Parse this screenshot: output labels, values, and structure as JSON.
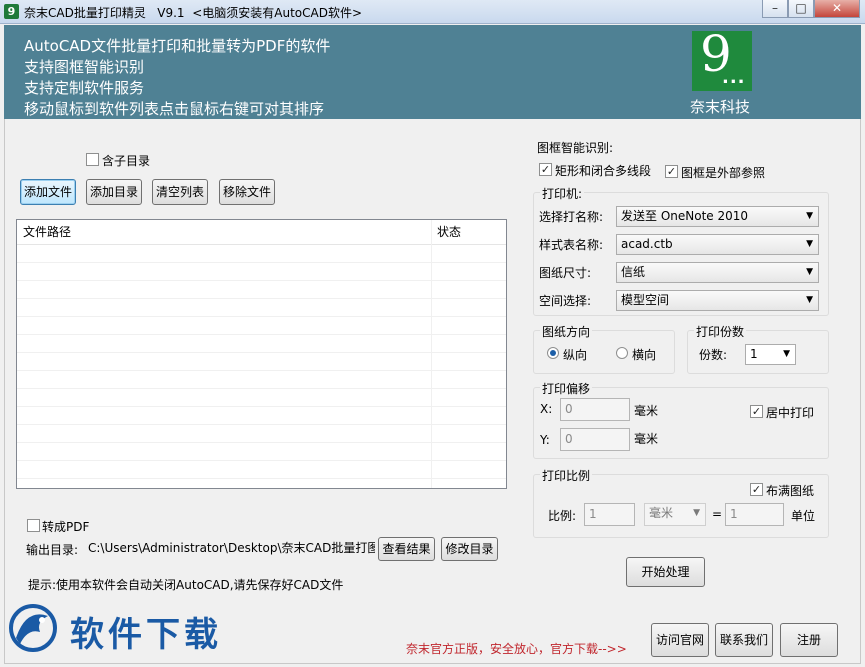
{
  "window": {
    "title": "奈末CAD批量打印精灵   V9.1  <电脑须安装有AutoCAD软件>",
    "icon_glyph": "9"
  },
  "banner": {
    "lines": [
      "AutoCAD文件批量打印和批量转为PDF的软件",
      "支持图框智能识别",
      "支持定制软件服务",
      "移动鼠标到软件列表点击鼠标右键可对其排序"
    ],
    "logo_numeral": "9",
    "logo_dots": "...",
    "company": "奈末科技",
    "bg_color": "#4f8194",
    "logo_color": "#1f8a3d"
  },
  "file_panel": {
    "include_subdir_label": "含子目录",
    "include_subdir_checked": false,
    "buttons": {
      "add_file": "添加文件",
      "add_dir": "添加目录",
      "clear_list": "清空列表",
      "remove_file": "移除文件"
    },
    "columns": [
      "文件路径",
      "状态"
    ],
    "rows": []
  },
  "output": {
    "to_pdf_label": "转成PDF",
    "to_pdf_checked": false,
    "dir_label": "输出目录:",
    "dir_value": "C:\\Users\\Administrator\\Desktop\\奈末CAD批量打图精",
    "view_result": "查看结果",
    "change_dir": "修改目录",
    "hint": "提示:使用本软件会自动关闭AutoCAD,请先保存好CAD文件"
  },
  "frame_detect": {
    "title": "图框智能识别:",
    "rect_polyline_label": "矩形和闭合多线段",
    "rect_polyline_checked": true,
    "external_ref_label": "图框是外部参照",
    "external_ref_checked": true
  },
  "printer": {
    "group_title": "打印机:",
    "printer_label": "选择打名称:",
    "printer_value": "发送至 OneNote 2010",
    "style_label": "样式表名称:",
    "style_value": "acad.ctb",
    "paper_label": "图纸尺寸:",
    "paper_value": "信纸",
    "space_label": "空间选择:",
    "space_value": "模型空间"
  },
  "orientation": {
    "title": "图纸方向",
    "portrait": "纵向",
    "landscape": "横向",
    "selected": "portrait"
  },
  "copies": {
    "title": "打印份数",
    "label": "份数:",
    "value": "1"
  },
  "offset": {
    "title": "打印偏移",
    "x_label": "X:",
    "x_value": "0",
    "y_label": "Y:",
    "y_value": "0",
    "unit": "毫米",
    "center_label": "居中打印",
    "center_checked": true
  },
  "scale": {
    "title": "打印比例",
    "fit_label": "布满图纸",
    "fit_checked": true,
    "ratio_label": "比例:",
    "left_value": "1",
    "unit_select": "毫米",
    "equals": "=",
    "right_value": "1",
    "unit_label": "单位"
  },
  "actions": {
    "start": "开始处理",
    "visit_site": "访问官网",
    "contact": "联系我们",
    "register": "注册"
  },
  "footer": {
    "watermark": "软件下载",
    "promo": "奈末官方正版，安全放心，官方下载-->>"
  }
}
